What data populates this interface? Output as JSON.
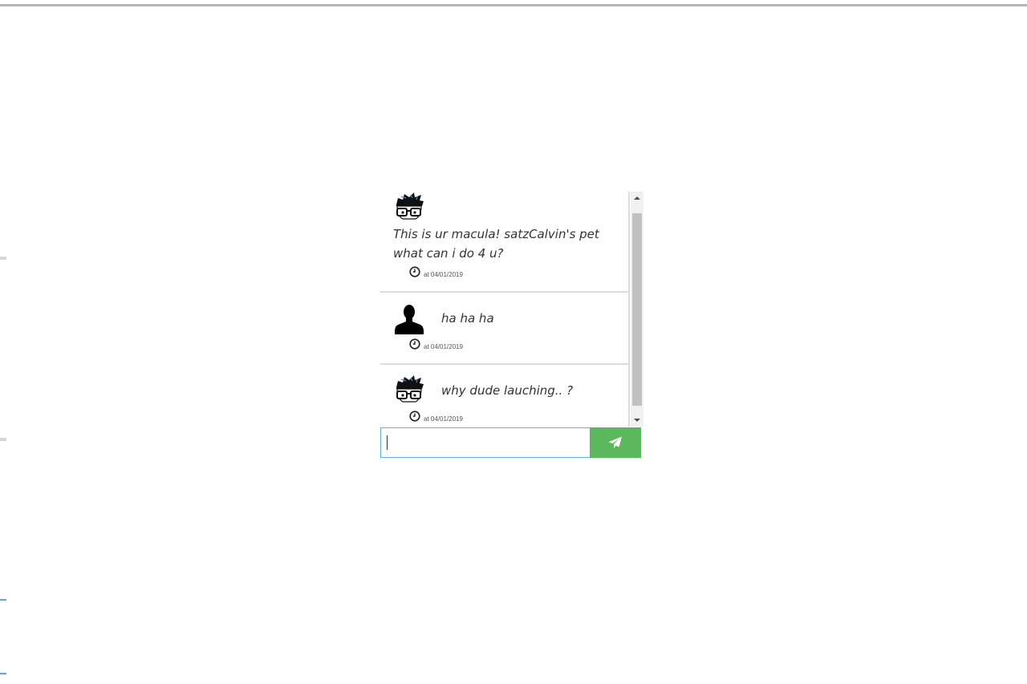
{
  "chat": {
    "messages": [
      {
        "sender": "bot",
        "avatar_icon": "nerd-glasses-avatar-icon",
        "text": "This is ur macula! satzCalvin's pet what can i do 4 u?",
        "timestamp": "at 04/01/2019"
      },
      {
        "sender": "user",
        "avatar_icon": "user-silhouette-icon",
        "text": "ha ha ha",
        "timestamp": "at 04/01/2019"
      },
      {
        "sender": "bot",
        "avatar_icon": "nerd-glasses-avatar-icon",
        "text": "why dude lauching.. ?",
        "timestamp": "at 04/01/2019"
      }
    ],
    "input": {
      "value": "",
      "placeholder": ""
    },
    "send_icon": "paper-plane-icon"
  },
  "colors": {
    "send_button": "#5cb85c",
    "input_focus_border": "#66afe9",
    "divider": "#dcdcdc",
    "scroll_thumb": "#c1c1c1"
  }
}
